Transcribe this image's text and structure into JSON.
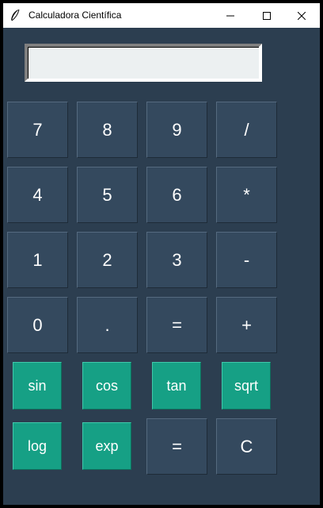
{
  "window": {
    "title": "Calculadora Científica",
    "icon": "feather-icon",
    "controls": [
      "minimize-icon",
      "maximize-icon",
      "close-icon"
    ]
  },
  "display": {
    "value": ""
  },
  "keypad": {
    "row1": [
      "7",
      "8",
      "9",
      "/"
    ],
    "row2": [
      "4",
      "5",
      "6",
      "*"
    ],
    "row3": [
      "1",
      "2",
      "3",
      "-"
    ],
    "row4": [
      "0",
      ".",
      "=",
      "+"
    ],
    "row5": [
      "sin",
      "cos",
      "tan",
      "sqrt"
    ],
    "row6": [
      "log",
      "exp",
      "=",
      "C"
    ]
  },
  "colors": {
    "background": "#2c3e50",
    "button": "#34495e",
    "scientific_button": "#16a085",
    "display": "#ecf0f1",
    "text": "#ffffff"
  }
}
